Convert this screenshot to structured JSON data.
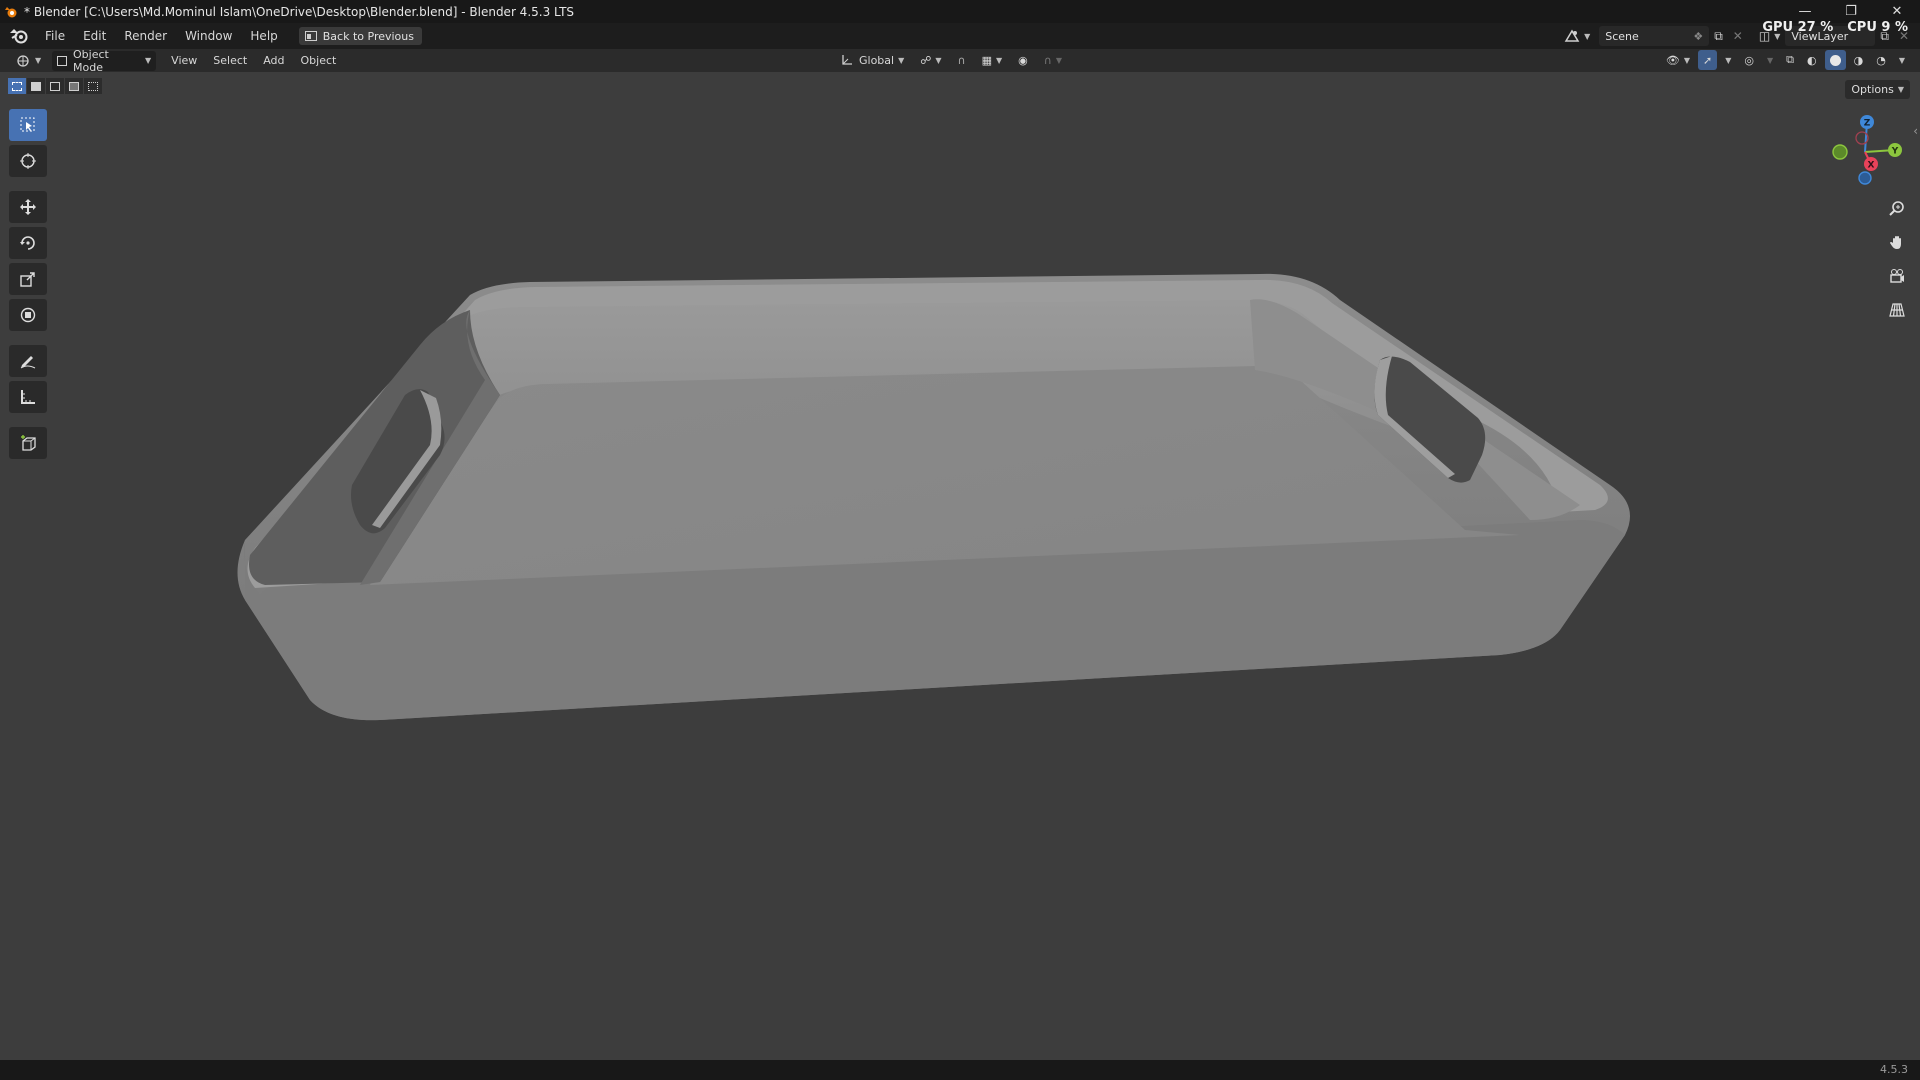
{
  "window": {
    "title": "* Blender [C:\\Users\\Md.Mominul Islam\\OneDrive\\Desktop\\Blender.blend] - Blender 4.5.3 LTS",
    "minimize_icon": "minimize-icon",
    "maximize_icon": "restore-icon",
    "close_icon": "close-icon"
  },
  "menubar": {
    "items": [
      "File",
      "Edit",
      "Render",
      "Window",
      "Help"
    ],
    "back_button": "Back to Previous",
    "scene_label": "Scene",
    "view_layer_label": "ViewLayer"
  },
  "stats": {
    "gpu": "GPU 27 %",
    "cpu": "CPU 9 %"
  },
  "header": {
    "mode": "Object Mode",
    "menus": [
      "View",
      "Select",
      "Add",
      "Object"
    ],
    "transform_orientation": "Global"
  },
  "viewport": {
    "options_label": "Options",
    "gizmo_axes": [
      "X",
      "Y",
      "Z"
    ],
    "axis_colors": {
      "x": "#e8425a",
      "y": "#8cc63e",
      "z": "#3f88d9"
    },
    "accent": "#4772b3"
  },
  "statusbar": {
    "version": "4.5.3"
  }
}
